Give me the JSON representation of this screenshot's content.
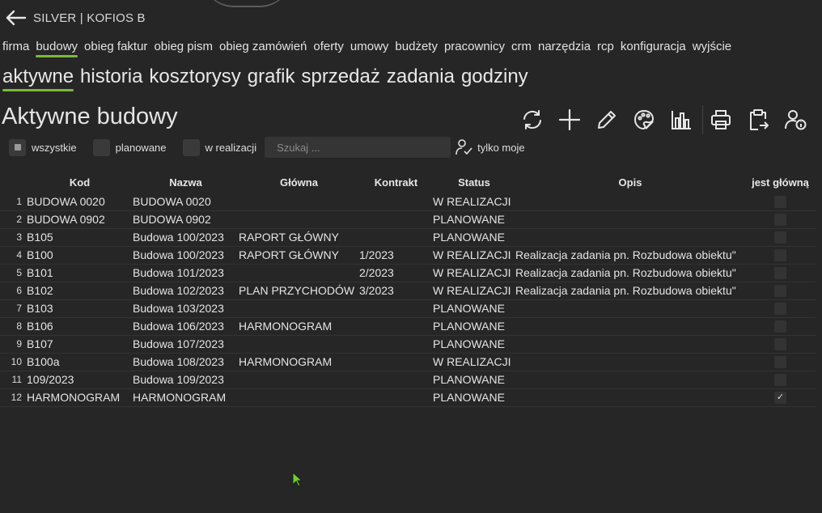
{
  "app": {
    "title": "SILVER | KOFIOS B"
  },
  "mainnav": [
    "firma",
    "budowy",
    "obieg faktur",
    "obieg pism",
    "obieg zamówień",
    "oferty",
    "umowy",
    "budżety",
    "pracownicy",
    "crm",
    "narzędzia",
    "rcp",
    "konfiguracja",
    "wyjście"
  ],
  "mainnav_active": "budowy",
  "subnav": [
    "aktywne",
    "historia",
    "kosztorysy",
    "grafik",
    "sprzedaż",
    "zadania",
    "godziny"
  ],
  "subnav_active": "aktywne",
  "page_title": "Aktywne budowy",
  "toolbar": [
    "refresh-icon",
    "plus-icon",
    "pencil-icon",
    "palette-icon",
    "bar-chart-icon",
    "printer-icon",
    "clipboard-export-icon",
    "user-info-icon"
  ],
  "filters": {
    "all": "wszystkie",
    "planned": "planowane",
    "in_progress": "w realizacji",
    "search_placeholder": "Szukaj ...",
    "only_mine": "tylko moje"
  },
  "table": {
    "columns": [
      "Kod",
      "Nazwa",
      "Główna",
      "Kontrakt",
      "Status",
      "Opis",
      "jest główną"
    ],
    "rows": [
      {
        "n": "1",
        "kod": "BUDOWA 0020",
        "nazwa": "BUDOWA 0020",
        "glowna": "",
        "kontrakt": "",
        "status": "W REALIZACJI",
        "opis": "",
        "jg": ""
      },
      {
        "n": "2",
        "kod": "BUDOWA 0902",
        "nazwa": "BUDOWA 0902",
        "glowna": "",
        "kontrakt": "",
        "status": "PLANOWANE",
        "opis": "",
        "jg": ""
      },
      {
        "n": "3",
        "kod": "B105",
        "nazwa": "Budowa 100/2023",
        "glowna": "RAPORT GŁÓWNY",
        "kontrakt": "",
        "status": "PLANOWANE",
        "opis": "",
        "jg": ""
      },
      {
        "n": "4",
        "kod": "B100",
        "nazwa": "Budowa 100/2023",
        "glowna": "RAPORT GŁÓWNY",
        "kontrakt": "1/2023",
        "status": "W REALIZACJI",
        "opis": "Realizacja zadania pn. Rozbudowa obiektu\"",
        "jg": ""
      },
      {
        "n": "5",
        "kod": "B101",
        "nazwa": "Budowa 101/2023",
        "glowna": "",
        "kontrakt": "2/2023",
        "status": "W REALIZACJI",
        "opis": "Realizacja zadania pn. Rozbudowa obiektu\"",
        "jg": ""
      },
      {
        "n": "6",
        "kod": "B102",
        "nazwa": "Budowa 102/2023",
        "glowna": "PLAN PRZYCHODÓW",
        "kontrakt": "3/2023",
        "status": "W REALIZACJI",
        "opis": "Realizacja zadania pn. Rozbudowa obiektu\"",
        "jg": ""
      },
      {
        "n": "7",
        "kod": "B103",
        "nazwa": "Budowa 103/2023",
        "glowna": "",
        "kontrakt": "",
        "status": "PLANOWANE",
        "opis": "",
        "jg": ""
      },
      {
        "n": "8",
        "kod": "B106",
        "nazwa": "Budowa 106/2023",
        "glowna": "HARMONOGRAM",
        "kontrakt": "",
        "status": "PLANOWANE",
        "opis": "",
        "jg": ""
      },
      {
        "n": "9",
        "kod": "B107",
        "nazwa": "Budowa 107/2023",
        "glowna": "",
        "kontrakt": "",
        "status": "PLANOWANE",
        "opis": "",
        "jg": ""
      },
      {
        "n": "10",
        "kod": "B100a",
        "nazwa": "Budowa 108/2023",
        "glowna": "HARMONOGRAM",
        "kontrakt": "",
        "status": "W REALIZACJI",
        "opis": "",
        "jg": ""
      },
      {
        "n": "11",
        "kod": "109/2023",
        "nazwa": "Budowa 109/2023",
        "glowna": "",
        "kontrakt": "",
        "status": "PLANOWANE",
        "opis": "",
        "jg": ""
      },
      {
        "n": "12",
        "kod": "HARMONOGRAM",
        "nazwa": "HARMONOGRAM",
        "glowna": "",
        "kontrakt": "",
        "status": "PLANOWANE",
        "opis": "",
        "jg": "✓"
      }
    ]
  },
  "colors": {
    "accent": "#7cb83a",
    "background": "#262626"
  }
}
